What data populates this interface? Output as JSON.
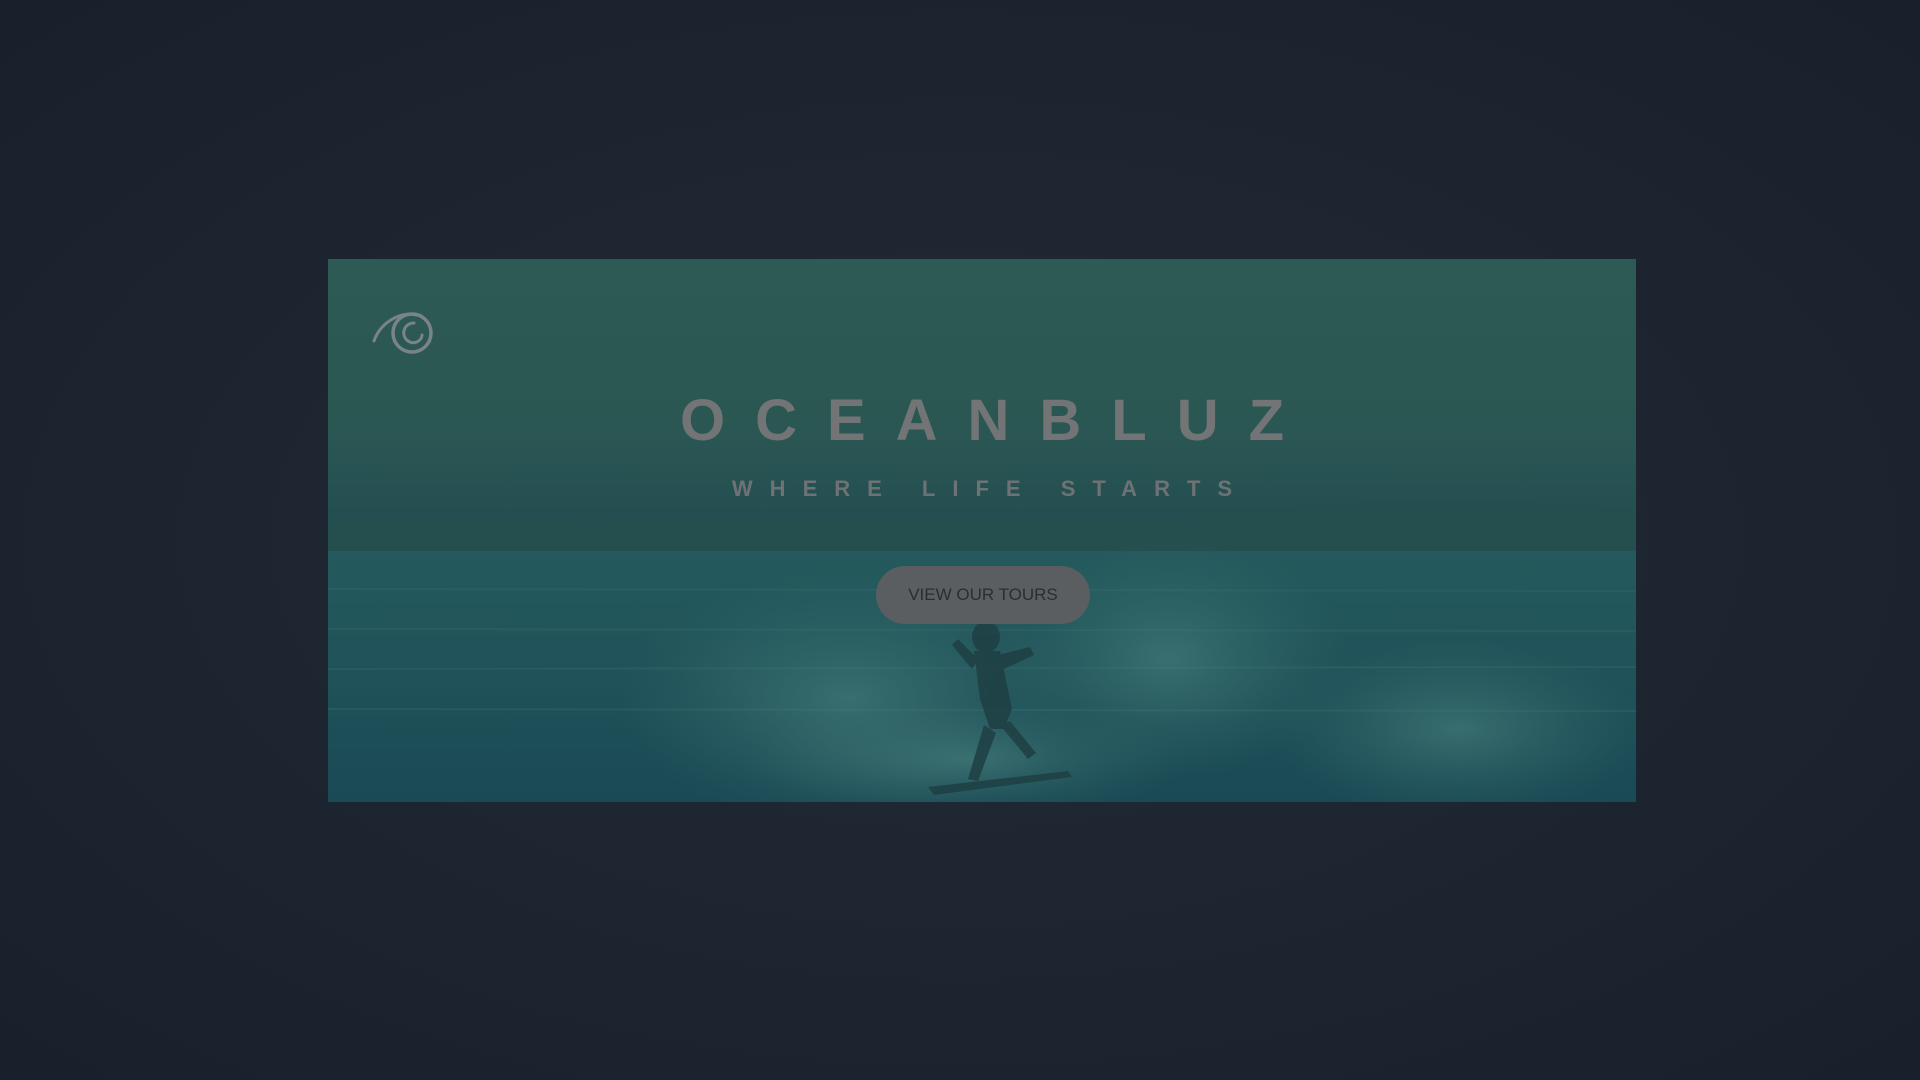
{
  "hero": {
    "brand_title": "OCEANBLUZ",
    "tagline": "WHERE LIFE STARTS",
    "cta_label": "VIEW OUR TOURS",
    "logo_icon": "wave-logo-icon",
    "background_image": "surfer-riding-wave-photo"
  },
  "colors": {
    "page_background": "#1c2330",
    "hero_tint": "#2b5753",
    "button": "#5b5e60",
    "title_text": "#727476"
  }
}
